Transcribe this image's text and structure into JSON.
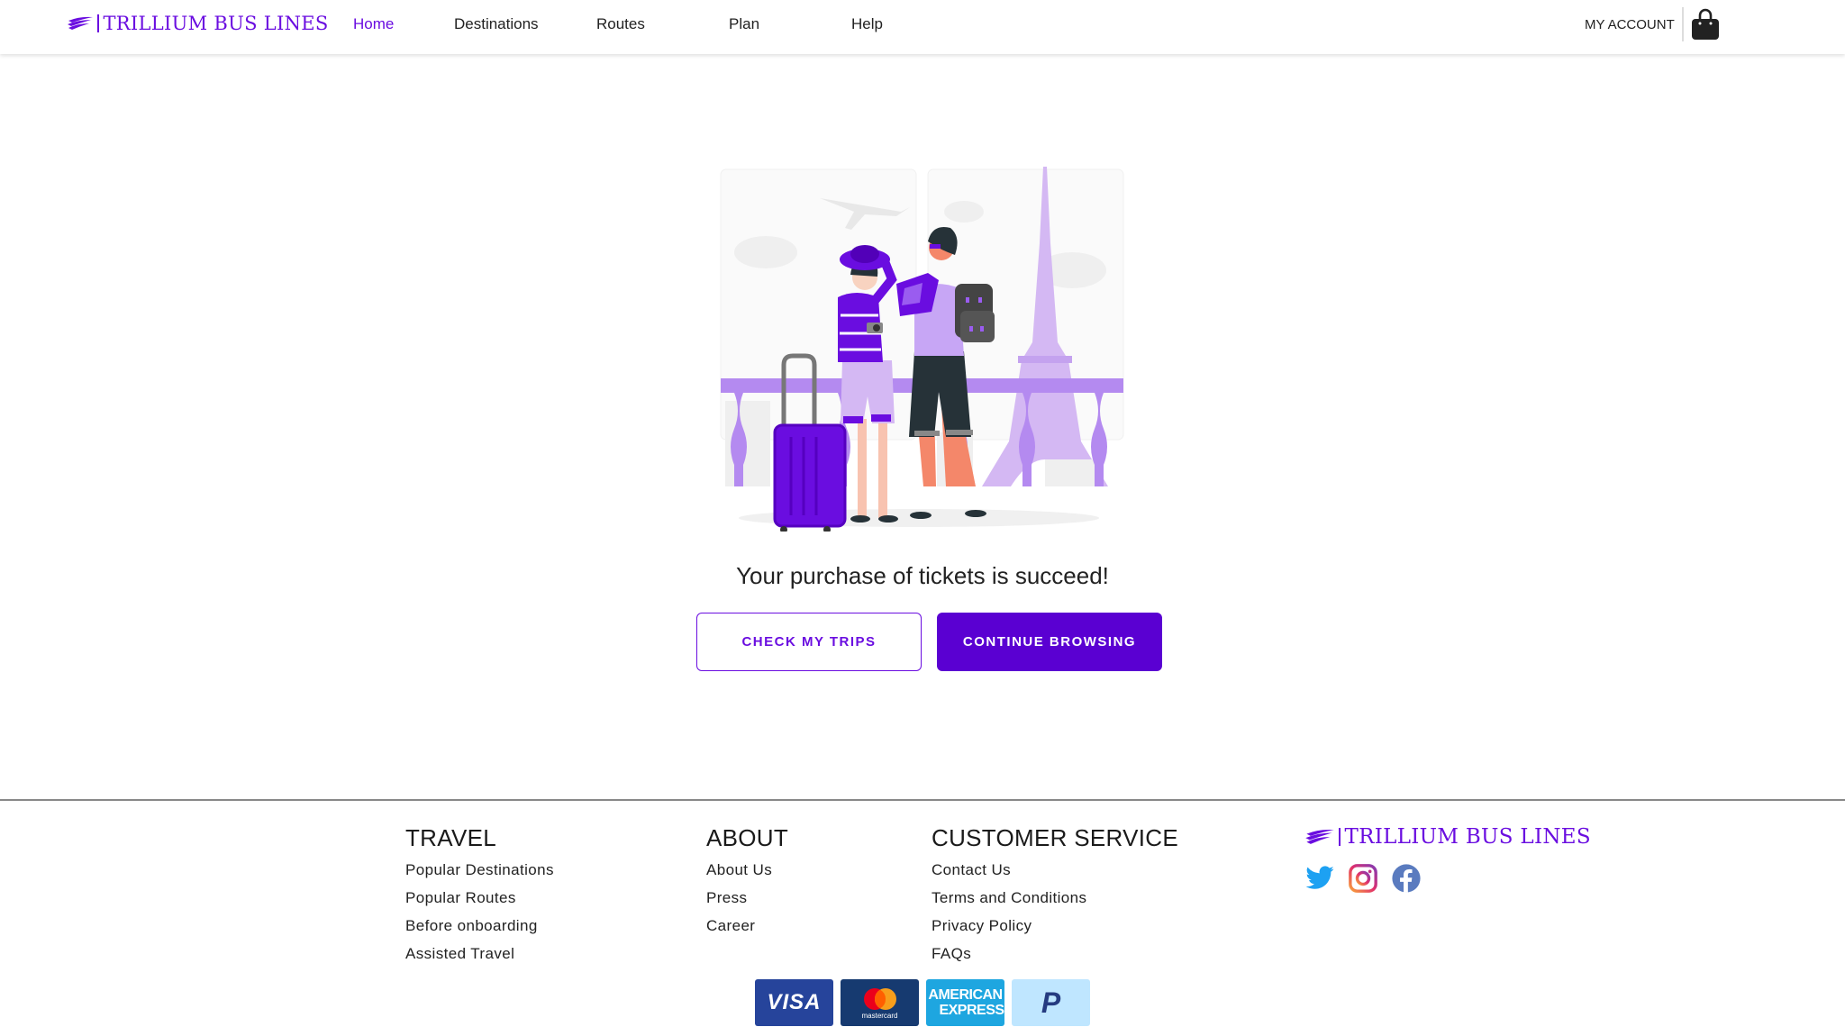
{
  "brand": {
    "name": "TRILLIUM BUS LINES",
    "color": "#6a0de0"
  },
  "nav": {
    "items": [
      {
        "label": "Home",
        "active": true
      },
      {
        "label": "Destinations",
        "active": false
      },
      {
        "label": "Routes",
        "active": false
      },
      {
        "label": "Plan",
        "active": false
      },
      {
        "label": "Help",
        "active": false
      }
    ],
    "account_label": "MY ACCOUNT",
    "cart_icon": "shopping-bag-icon"
  },
  "main": {
    "illustration": "travelers-paris-illustration",
    "message": "Your purchase of tickets is succeed!",
    "check_trips_label": "CHECK MY TRIPS",
    "continue_label": "CONTINUE BROWSING",
    "primary_color": "#5a00d2"
  },
  "footer": {
    "columns": [
      {
        "title": "TRAVEL",
        "links": [
          "Popular Destinations",
          "Popular Routes",
          "Before onboarding",
          "Assisted Travel"
        ]
      },
      {
        "title": "ABOUT",
        "links": [
          "About Us",
          "Press",
          "Career"
        ]
      },
      {
        "title": "CUSTOMER SERVICE",
        "links": [
          "Contact Us",
          "Terms and Conditions",
          "Privacy Policy",
          "FAQs"
        ]
      }
    ],
    "brand_name": "TRILLIUM BUS LINES",
    "social": [
      "twitter-icon",
      "instagram-icon",
      "facebook-icon"
    ],
    "payment": {
      "visa": "VISA",
      "mastercard": "mastercard",
      "amex_line1": "AMERICAN",
      "amex_line2": "EXPRESS",
      "paypal": "P"
    }
  }
}
